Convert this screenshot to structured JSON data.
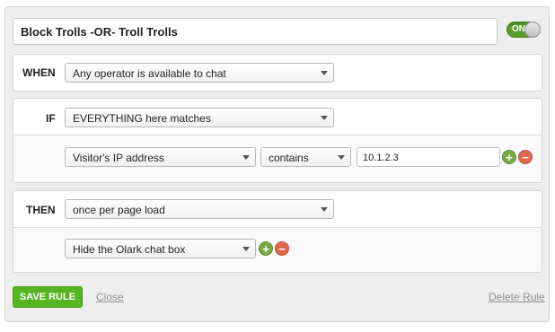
{
  "rule": {
    "title": "Block Trolls -OR- Troll Trolls",
    "toggle_label": "ON"
  },
  "when": {
    "keyword": "WHEN",
    "condition": "Any operator is available to chat"
  },
  "if": {
    "keyword": "IF",
    "match_mode": "EVERYTHING here matches",
    "criteria": {
      "field": "Visitor's IP address",
      "operator": "contains",
      "value": "10.1.2.3"
    }
  },
  "then": {
    "keyword": "THEN",
    "frequency": "once per page load",
    "action": "Hide the Olark chat box"
  },
  "footer": {
    "save_label": "SAVE RULE",
    "close_label": "Close",
    "delete_label": "Delete Rule"
  },
  "colors": {
    "accent_green": "#56b622",
    "toggle_green": "#5a9e2f",
    "remove_red": "#e0674f",
    "add_green": "#7aaa45"
  }
}
